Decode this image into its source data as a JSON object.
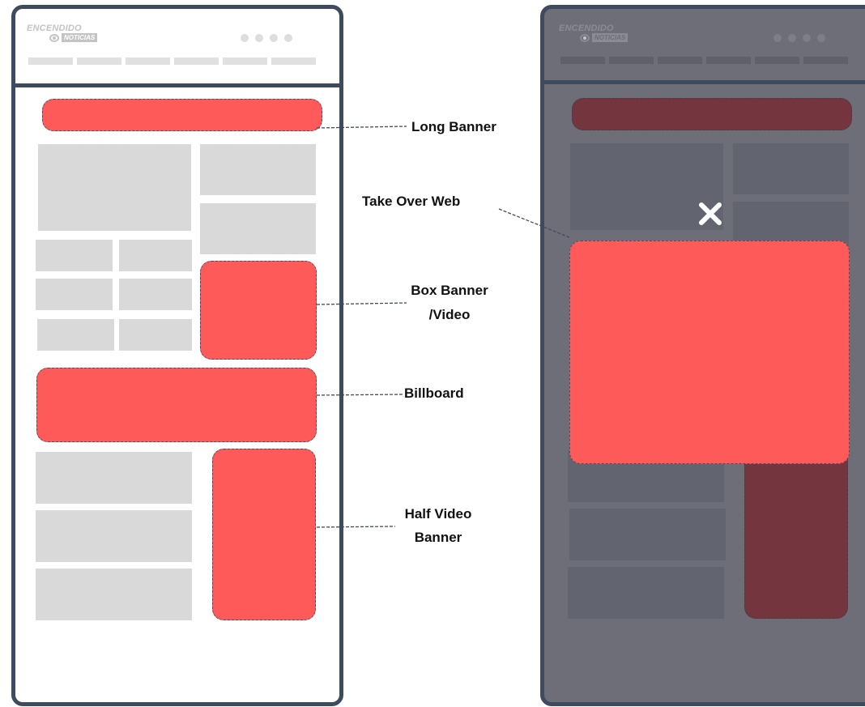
{
  "brand": {
    "name_top": "ENCENDIDO",
    "name_badge": "NOTICIAS"
  },
  "labels": {
    "long_banner": "Long Banner",
    "take_over_web": "Take Over Web",
    "box_banner_line1": "Box Banner",
    "box_banner_line2": "/Video",
    "billboard": "Billboard",
    "half_video_line1": "Half Video",
    "half_video_line2": "Banner"
  },
  "colors": {
    "frame": "#3e4a5e",
    "ad_red": "#ff5a5a",
    "placeholder_gray": "#d9d9d9",
    "overlay": "#6d6e78",
    "dim_ad_red": "#74353e"
  },
  "icons": {
    "close": "close-icon"
  }
}
